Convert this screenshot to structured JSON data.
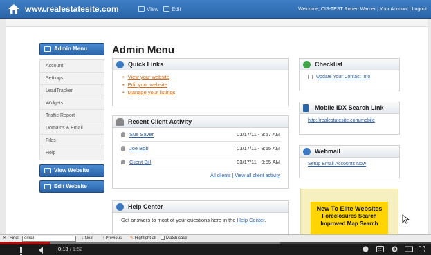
{
  "header": {
    "site": "www.realestatesite.com",
    "view": "View",
    "edit": "Edit",
    "welcome_prefix": "Welcome, ",
    "user": "CIS-TEST Robert Warner",
    "sep1": " | ",
    "account": "Your Account",
    "sep2": " | ",
    "logout": "Logout"
  },
  "sidebar": {
    "admin_button": "Admin Menu",
    "items": [
      "Account",
      "Settings",
      "LeadTracker",
      "Widgets",
      "Traffic Report",
      "Domains & Email",
      "Files",
      "Help"
    ],
    "view_website": "View Website",
    "edit_website": "Edit Website"
  },
  "main": {
    "title": "Admin Menu",
    "quick_links": {
      "title": "Quick Links",
      "links": [
        "View your website",
        "Edit your website",
        "Manage your listings"
      ]
    },
    "activity": {
      "title": "Recent Client Activity",
      "rows": [
        {
          "name": "Sue Saver",
          "date": "03/17/11 - 9:57 AM"
        },
        {
          "name": "Joe Bob",
          "date": "03/17/11 - 9:55 AM"
        },
        {
          "name": "Client Bill",
          "date": "03/17/11 - 9:55 AM"
        }
      ],
      "all_clients": "All clients",
      "sep": " | ",
      "view_all": "View all client activity"
    },
    "help": {
      "title": "Help Center",
      "text_before": "Get answers to most of your questions here in the ",
      "link": "Help Center",
      "text_after": "."
    }
  },
  "right": {
    "checklist": {
      "title": "Checklist",
      "item": "Update Your Contact Info"
    },
    "idx": {
      "title": "Mobile IDX Search Link",
      "link": "http://realestatesite.com/mobile"
    },
    "webmail": {
      "title": "Webmail",
      "link": "Setup Email Accounts Now"
    },
    "promo": {
      "line1": "New To Elite Websites",
      "line2": "Foreclosures Search",
      "line3": "Improved Map Search"
    }
  },
  "findbar": {
    "close": "✕",
    "label": "Find:",
    "value": "email",
    "next": "Next",
    "previous": "Previous",
    "highlight": "Highlight all",
    "match_case": "Match case"
  },
  "player": {
    "current": "0:13",
    "duration": " / 1:52",
    "progress": 0.116,
    "buffered": 0.65
  },
  "colors": {
    "brand_blue": "#2a64a8",
    "link": "#2e5ea8",
    "orange_link": "#d46a14",
    "promo_yellow": "#ffd400"
  }
}
